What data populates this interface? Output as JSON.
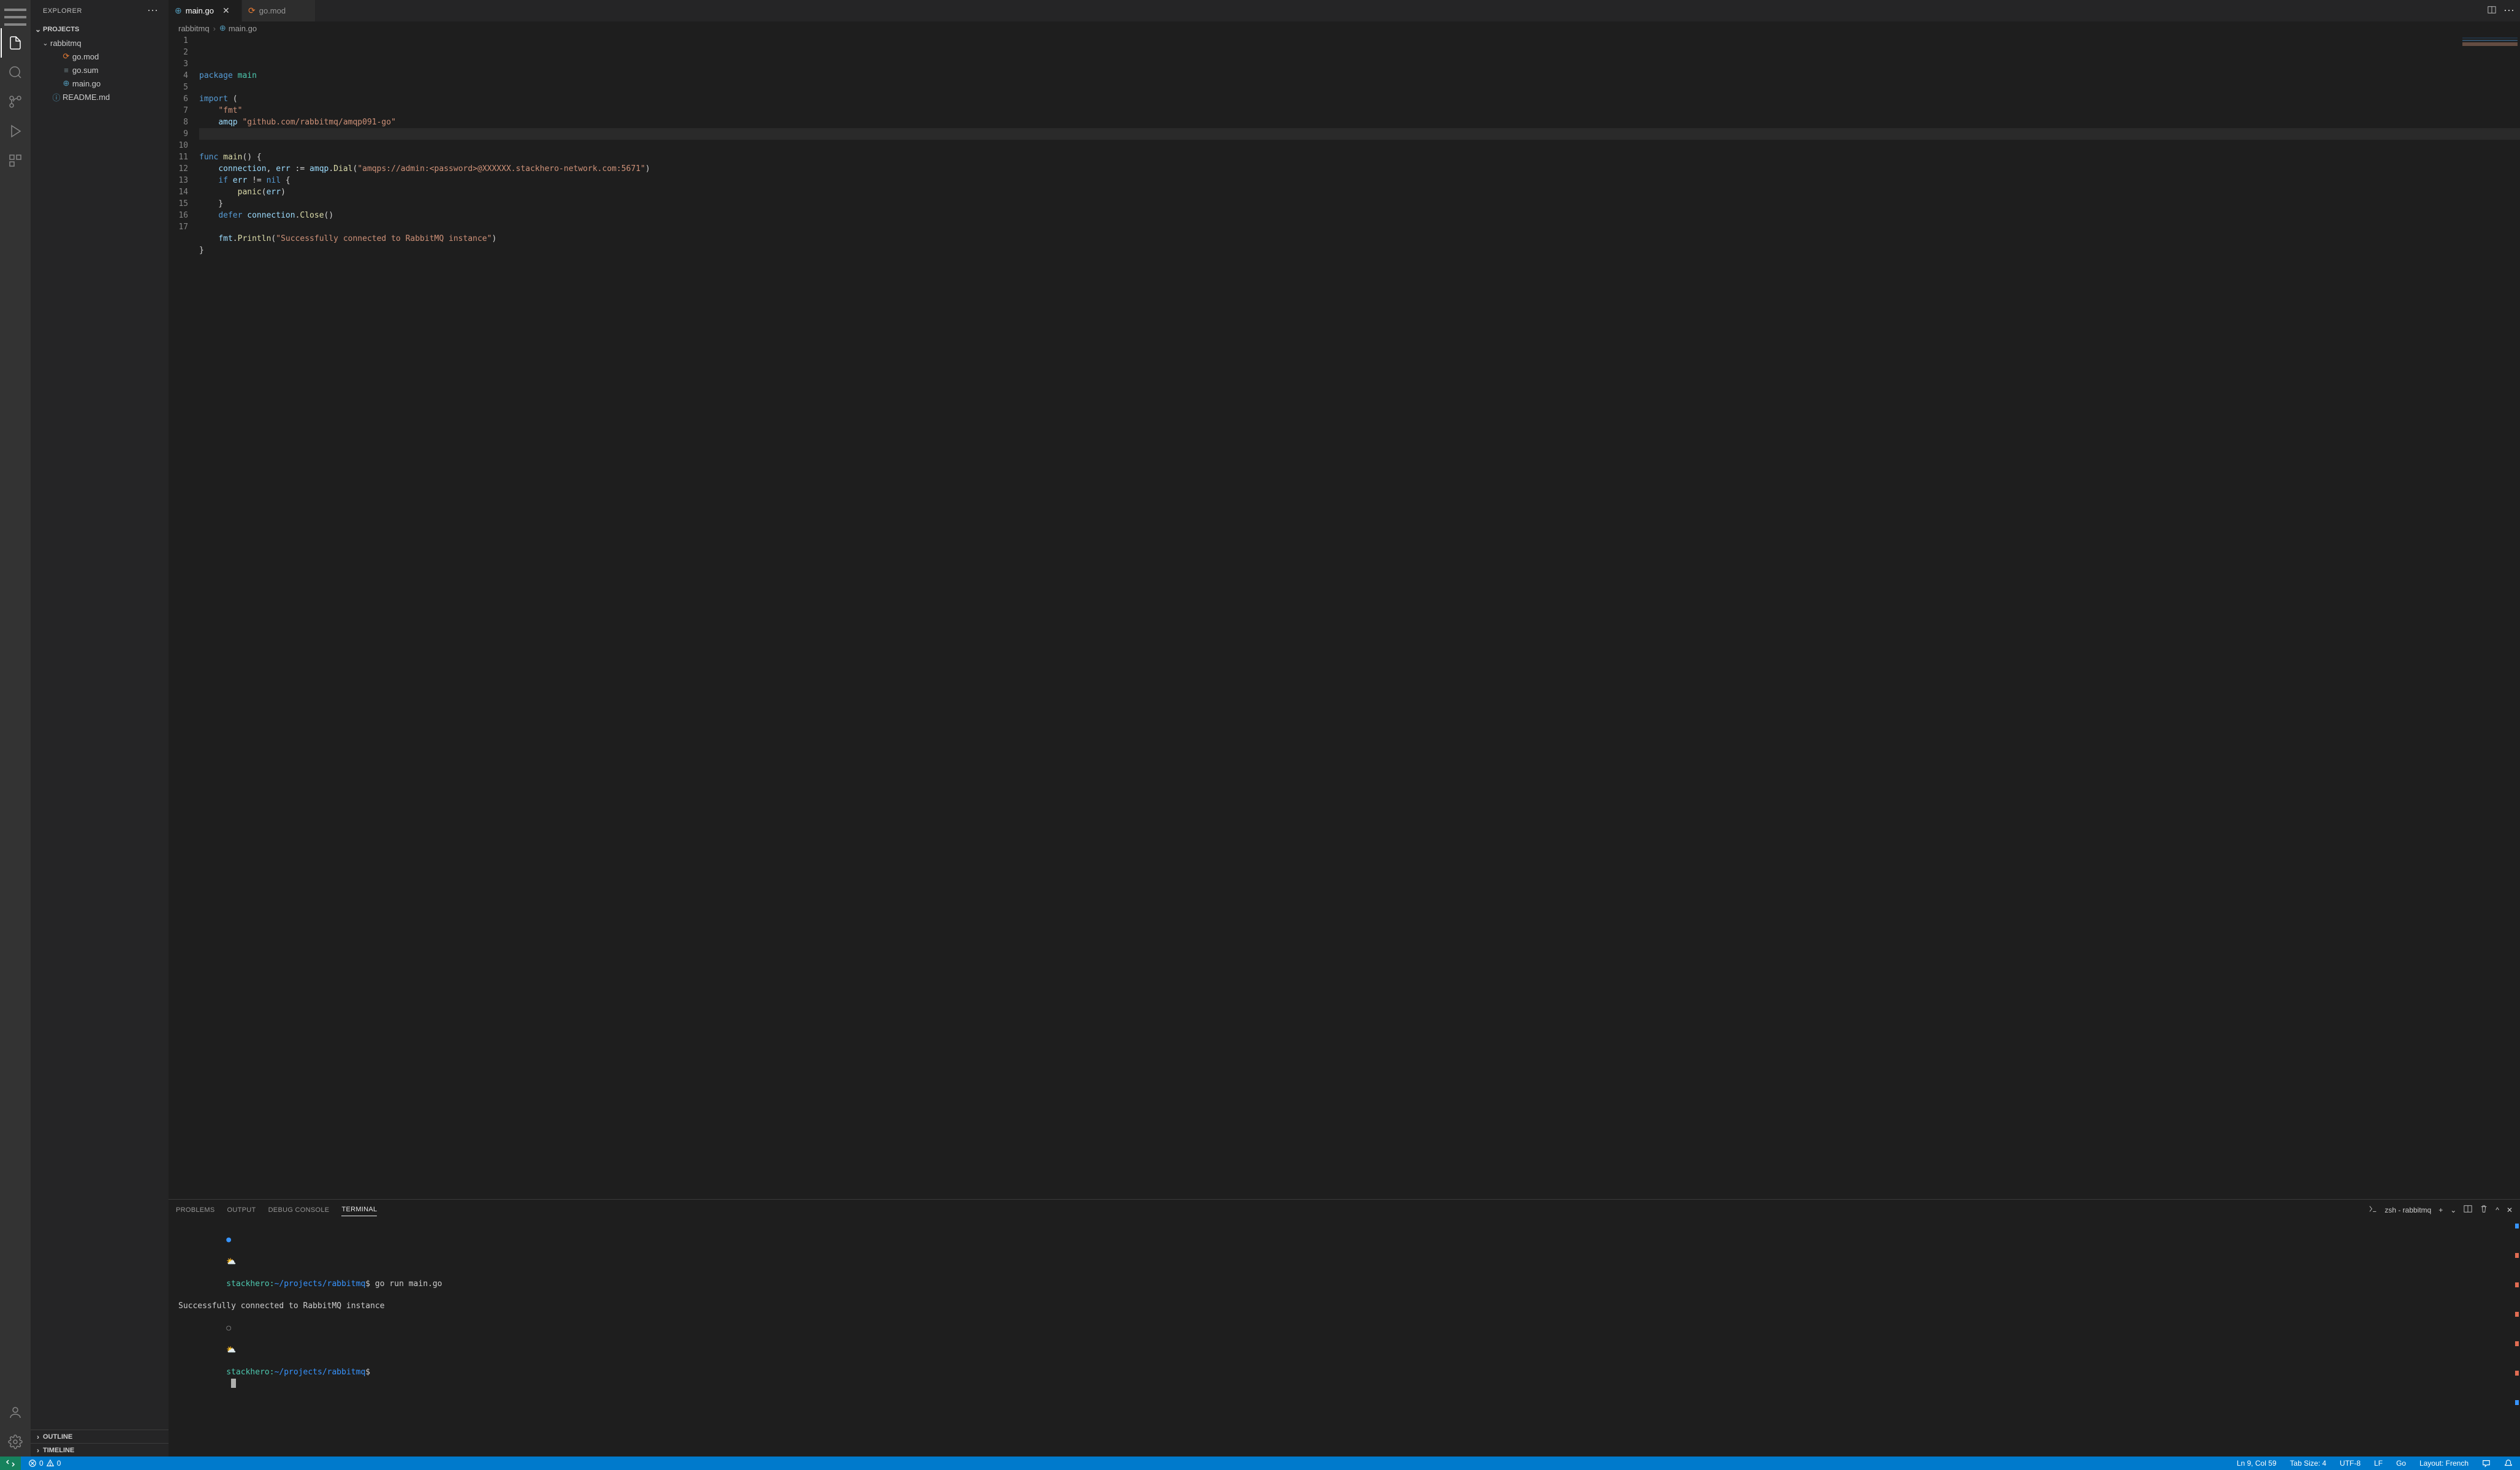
{
  "sidebar": {
    "title": "EXPLORER",
    "projects_label": "PROJECTS",
    "root_folder": "rabbitmq",
    "files": [
      {
        "name": "go.mod",
        "icon": "mod"
      },
      {
        "name": "go.sum",
        "icon": "sum"
      },
      {
        "name": "main.go",
        "icon": "go"
      }
    ],
    "root_siblings": [
      {
        "name": "README.md",
        "icon": "md"
      }
    ],
    "outline_label": "OUTLINE",
    "timeline_label": "TIMELINE"
  },
  "tabs": [
    {
      "name": "main.go",
      "icon": "go",
      "active": true,
      "dirty": false
    },
    {
      "name": "go.mod",
      "icon": "mod",
      "active": false,
      "dirty": false
    }
  ],
  "breadcrumbs": {
    "segments": [
      "rabbitmq",
      "main.go"
    ]
  },
  "code": {
    "lines": [
      [
        {
          "c": "tok-kw",
          "t": "package"
        },
        {
          "c": "",
          "t": " "
        },
        {
          "c": "tok-pkg",
          "t": "main"
        }
      ],
      [],
      [
        {
          "c": "tok-kw",
          "t": "import"
        },
        {
          "c": "",
          "t": " ("
        }
      ],
      [
        {
          "c": "",
          "t": "    "
        },
        {
          "c": "tok-str",
          "t": "\"fmt\""
        }
      ],
      [
        {
          "c": "",
          "t": "    "
        },
        {
          "c": "tok-ident",
          "t": "amqp"
        },
        {
          "c": "",
          "t": " "
        },
        {
          "c": "tok-str",
          "t": "\"github.com/rabbitmq/amqp091-go\""
        }
      ],
      [
        {
          "c": "",
          "t": ")"
        }
      ],
      [],
      [
        {
          "c": "tok-kw",
          "t": "func"
        },
        {
          "c": "",
          "t": " "
        },
        {
          "c": "tok-fn",
          "t": "main"
        },
        {
          "c": "",
          "t": "() {"
        }
      ],
      [
        {
          "c": "",
          "t": "    "
        },
        {
          "c": "tok-ident",
          "t": "connection"
        },
        {
          "c": "",
          "t": ", "
        },
        {
          "c": "tok-ident",
          "t": "err"
        },
        {
          "c": "",
          "t": " := "
        },
        {
          "c": "tok-ident",
          "t": "amqp"
        },
        {
          "c": "",
          "t": "."
        },
        {
          "c": "tok-fn",
          "t": "Dial"
        },
        {
          "c": "",
          "t": "("
        },
        {
          "c": "tok-str",
          "t": "\"amqps://admin:<password>@XXXXXX.stackhero-network.com:5671\""
        },
        {
          "c": "",
          "t": ")"
        }
      ],
      [
        {
          "c": "",
          "t": "    "
        },
        {
          "c": "tok-kw",
          "t": "if"
        },
        {
          "c": "",
          "t": " "
        },
        {
          "c": "tok-ident",
          "t": "err"
        },
        {
          "c": "",
          "t": " != "
        },
        {
          "c": "tok-nil",
          "t": "nil"
        },
        {
          "c": "",
          "t": " {"
        }
      ],
      [
        {
          "c": "",
          "t": "        "
        },
        {
          "c": "tok-fn",
          "t": "panic"
        },
        {
          "c": "",
          "t": "("
        },
        {
          "c": "tok-ident",
          "t": "err"
        },
        {
          "c": "",
          "t": ")"
        }
      ],
      [
        {
          "c": "",
          "t": "    }"
        }
      ],
      [
        {
          "c": "",
          "t": "    "
        },
        {
          "c": "tok-kw",
          "t": "defer"
        },
        {
          "c": "",
          "t": " "
        },
        {
          "c": "tok-ident",
          "t": "connection"
        },
        {
          "c": "",
          "t": "."
        },
        {
          "c": "tok-fn",
          "t": "Close"
        },
        {
          "c": "",
          "t": "()"
        }
      ],
      [],
      [
        {
          "c": "",
          "t": "    "
        },
        {
          "c": "tok-ident",
          "t": "fmt"
        },
        {
          "c": "",
          "t": "."
        },
        {
          "c": "tok-fn",
          "t": "Println"
        },
        {
          "c": "",
          "t": "("
        },
        {
          "c": "tok-str",
          "t": "\"Successfully connected to RabbitMQ instance\""
        },
        {
          "c": "",
          "t": ")"
        }
      ],
      [
        {
          "c": "",
          "t": "}"
        }
      ],
      []
    ],
    "highlight_line": 9
  },
  "panel": {
    "tabs": [
      "PROBLEMS",
      "OUTPUT",
      "DEBUG CONSOLE",
      "TERMINAL"
    ],
    "active_tab": "TERMINAL",
    "terminal_label": "zsh - rabbitmq",
    "terminal": {
      "line1_bullet": "●",
      "line1_emoji": "⛅",
      "line1_user": "stackhero",
      "line1_sep": ":",
      "line1_path": "~/projects/rabbitmq",
      "line1_dollar": "$",
      "line1_cmd": " go run main.go",
      "line2": "Successfully connected to RabbitMQ instance",
      "line3_bullet": "○",
      "line3_emoji": "⛅",
      "line3_user": "stackhero",
      "line3_sep": ":",
      "line3_path": "~/projects/rabbitmq",
      "line3_dollar": "$"
    }
  },
  "status": {
    "errors": "0",
    "warnings": "0",
    "cursor": "Ln 9, Col 59",
    "tabsize": "Tab Size: 4",
    "encoding": "UTF-8",
    "eol": "LF",
    "language": "Go",
    "layout": "Layout: French"
  }
}
